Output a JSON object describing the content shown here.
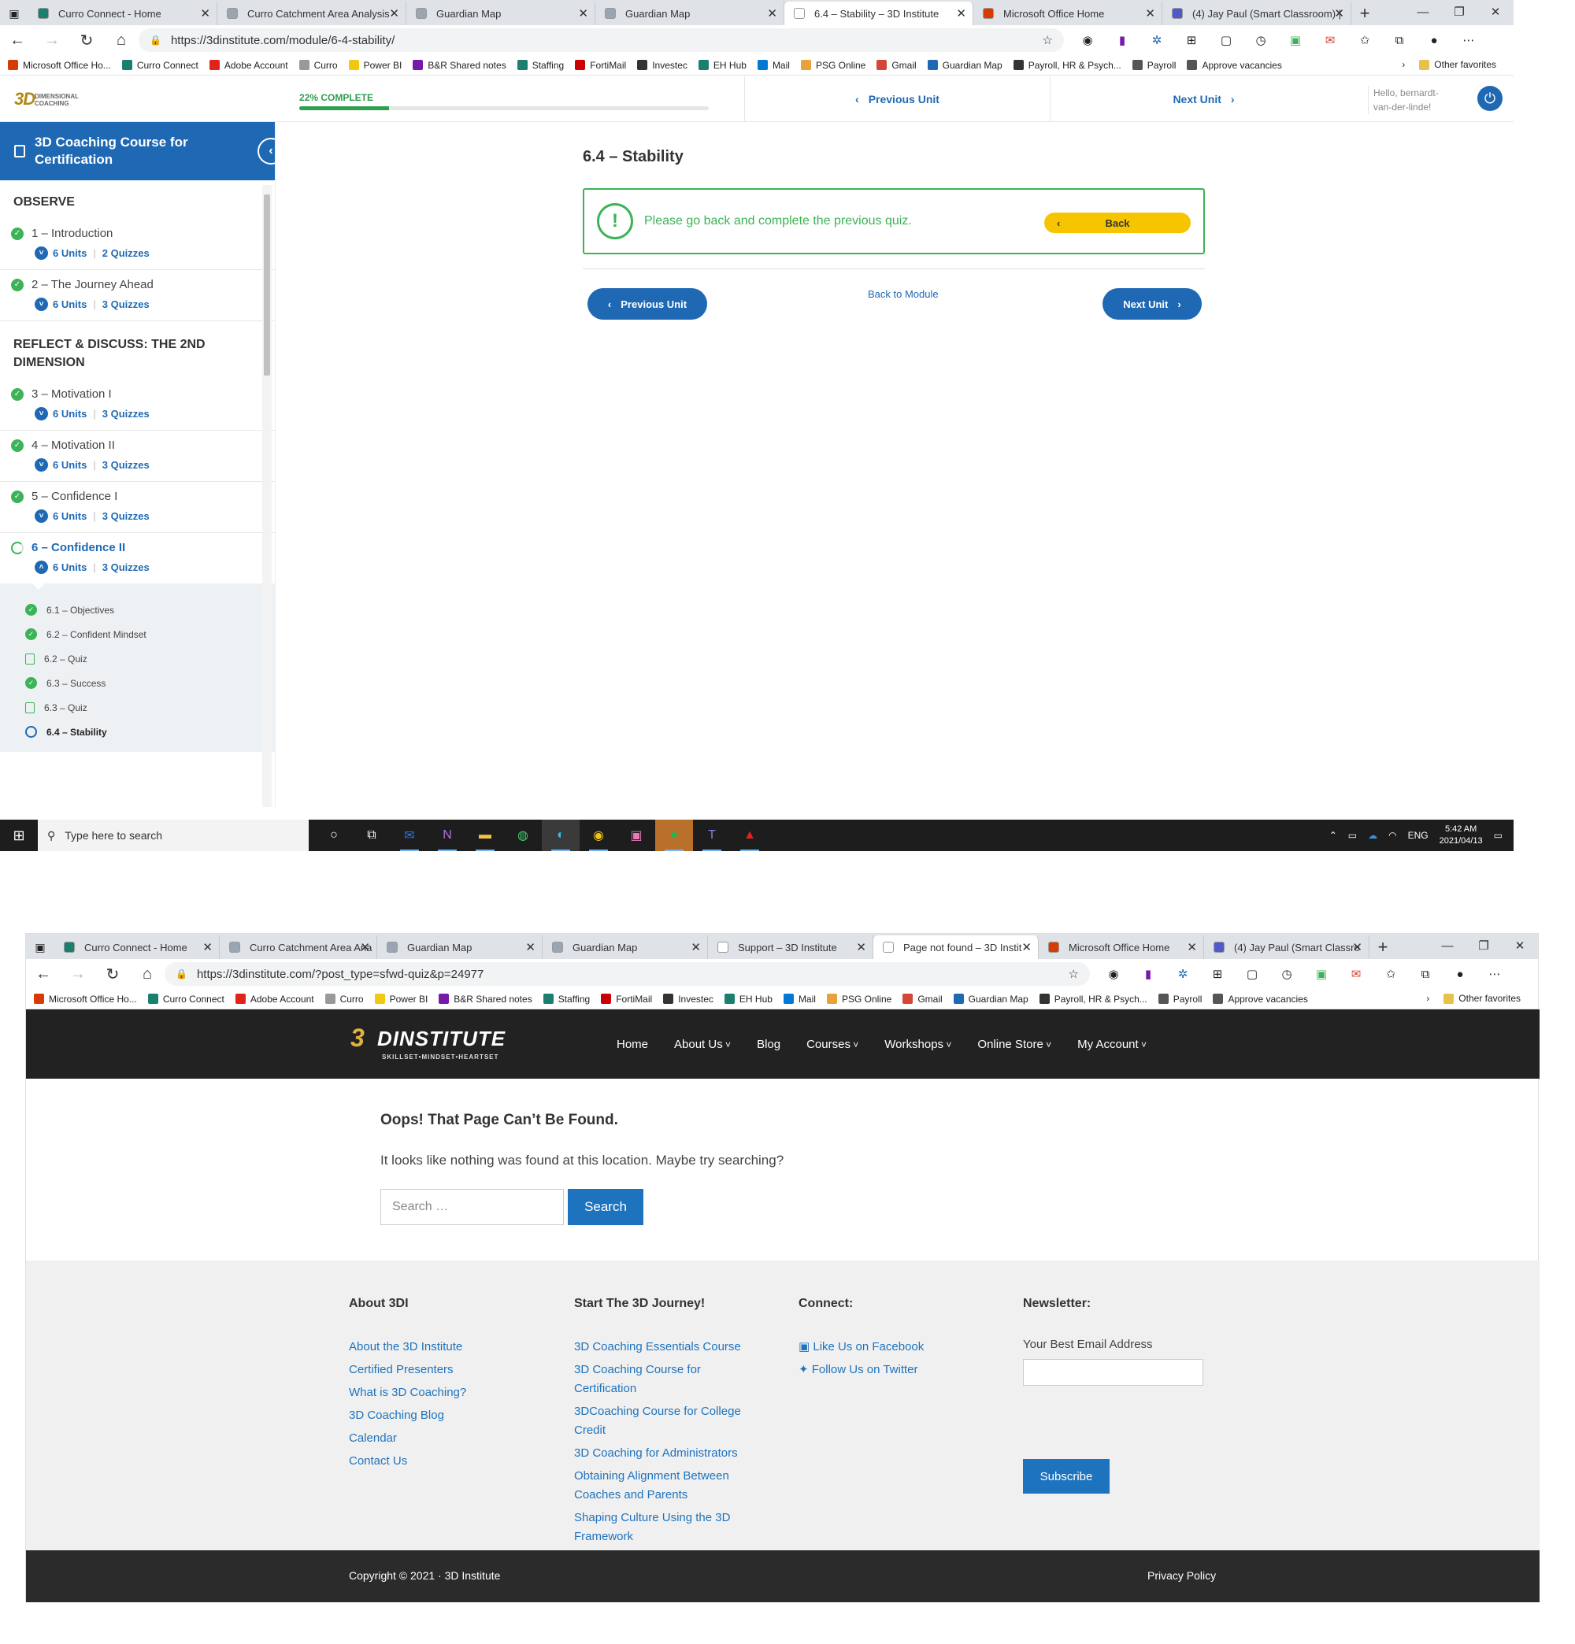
{
  "shot1": {
    "tabs": [
      {
        "label": "Curro Connect - Home",
        "color": "#1a7f6e"
      },
      {
        "label": "Curro Catchment Area Analysis",
        "color": "#9aa5b1"
      },
      {
        "label": "Guardian Map",
        "color": "#9aa5b1"
      },
      {
        "label": "Guardian Map",
        "color": "#9aa5b1"
      },
      {
        "label": "6.4 – Stability – 3D Institute",
        "color": "#ffffff"
      },
      {
        "label": "Microsoft Office Home",
        "color": "#d83b01"
      },
      {
        "label": "(4) Jay Paul (Smart Classroom) |",
        "color": "#5059c9"
      }
    ],
    "url": "https://3dinstitute.com/module/6-4-stability/",
    "favorites": [
      "Microsoft Office Ho...",
      "Curro Connect",
      "Adobe Account",
      "Curro",
      "Power BI",
      "B&R Shared notes",
      "Staffing",
      "FortiMail",
      "Investec",
      "EH Hub",
      "Mail",
      "PSG Online",
      "Gmail",
      "Guardian Map",
      "Payroll, HR & Psych...",
      "Payroll",
      "Approve vacancies"
    ],
    "other_favorites": "Other favorites",
    "progress": {
      "label": "22% COMPLETE",
      "percent": 22
    },
    "prev_unit": "Previous Unit",
    "next_unit": "Next Unit",
    "hello": "Hello, bernardt-van-der-linde!",
    "course_title": "3D Coaching Course for Certification",
    "sections": {
      "observe": "OBSERVE",
      "reflect": "REFLECT & DISCUSS: THE 2ND DIMENSION"
    },
    "lessons": [
      {
        "title": "1 – Introduction",
        "units": "6 Units",
        "quizzes": "2 Quizzes"
      },
      {
        "title": "2 – The Journey Ahead",
        "units": "6 Units",
        "quizzes": "3 Quizzes"
      },
      {
        "title": "3 – Motivation I",
        "units": "6 Units",
        "quizzes": "3 Quizzes"
      },
      {
        "title": "4 – Motivation II",
        "units": "6 Units",
        "quizzes": "3 Quizzes"
      },
      {
        "title": "5 – Confidence I",
        "units": "6 Units",
        "quizzes": "3 Quizzes"
      },
      {
        "title": "6 – Confidence II",
        "units": "6 Units",
        "quizzes": "3 Quizzes"
      }
    ],
    "subunits": [
      {
        "label": "6.1 – Objectives",
        "icon": "check-circle-icon"
      },
      {
        "label": "6.2 – Confident Mindset",
        "icon": "check-circle-icon"
      },
      {
        "label": "6.2 – Quiz",
        "icon": "quiz-icon"
      },
      {
        "label": "6.3 – Success",
        "icon": "check-circle-icon"
      },
      {
        "label": "6.3 – Quiz",
        "icon": "quiz-icon"
      },
      {
        "label": "6.4 – Stability",
        "icon": "open-circle-icon"
      }
    ],
    "page_title": "6.4 – Stability",
    "alert_message": "Please go back and complete the previous quiz.",
    "back_button": "Back",
    "previous_unit_button": "Previous Unit",
    "back_to_module": "Back to Module",
    "next_unit_button": "Next Unit",
    "taskbar": {
      "search_placeholder": "Type here to search",
      "lang": "ENG",
      "time": "5:42 AM",
      "date": "2021/04/13"
    }
  },
  "shot2": {
    "tabs": [
      {
        "label": "Curro Connect - Home",
        "color": "#1a7f6e"
      },
      {
        "label": "Curro Catchment Area Ana",
        "color": "#9aa5b1"
      },
      {
        "label": "Guardian Map",
        "color": "#9aa5b1"
      },
      {
        "label": "Guardian Map",
        "color": "#9aa5b1"
      },
      {
        "label": "Support – 3D Institute",
        "color": "#ffffff"
      },
      {
        "label": "Page not found – 3D Instit",
        "color": "#ffffff"
      },
      {
        "label": "Microsoft Office Home",
        "color": "#d83b01"
      },
      {
        "label": "(4) Jay Paul (Smart Classro",
        "color": "#5059c9"
      }
    ],
    "url": "https://3dinstitute.com/?post_type=sfwd-quiz&p=24977",
    "brand": {
      "letter": "3",
      "word": "DINSTITUTE",
      "tagline": "SKILLSET•MINDSET•HEARTSET"
    },
    "menu": [
      "Home",
      "About Us",
      "Blog",
      "Courses",
      "Workshops",
      "Online Store",
      "My Account"
    ],
    "error_title": "Oops! That Page Can’t Be Found.",
    "error_text": "It looks like nothing was found at this location. Maybe try searching?",
    "search_placeholder": "Search …",
    "search_button": "Search",
    "footer": {
      "about_title": "About 3DI",
      "about_links": [
        "About the 3D Institute",
        "Certified Presenters",
        "What is 3D Coaching?",
        "3D Coaching Blog",
        "Calendar",
        "Contact Us"
      ],
      "journey_title": "Start The 3D Journey!",
      "journey_links": [
        "3D Coaching Essentials Course",
        "3D Coaching Course for Certification",
        "3DCoaching Course for College Credit",
        "3D Coaching for Administrators",
        "Obtaining Alignment Between Coaches and Parents",
        "Shaping Culture Using the 3D Framework"
      ],
      "connect_title": "Connect:",
      "facebook": "Like Us on Facebook",
      "twitter": "Follow Us on Twitter",
      "newsletter_title": "Newsletter:",
      "email_label": "Your Best Email Address",
      "subscribe": "Subscribe"
    },
    "copyright": "Copyright © 2021 · 3D Institute",
    "privacy": "Privacy Policy"
  }
}
